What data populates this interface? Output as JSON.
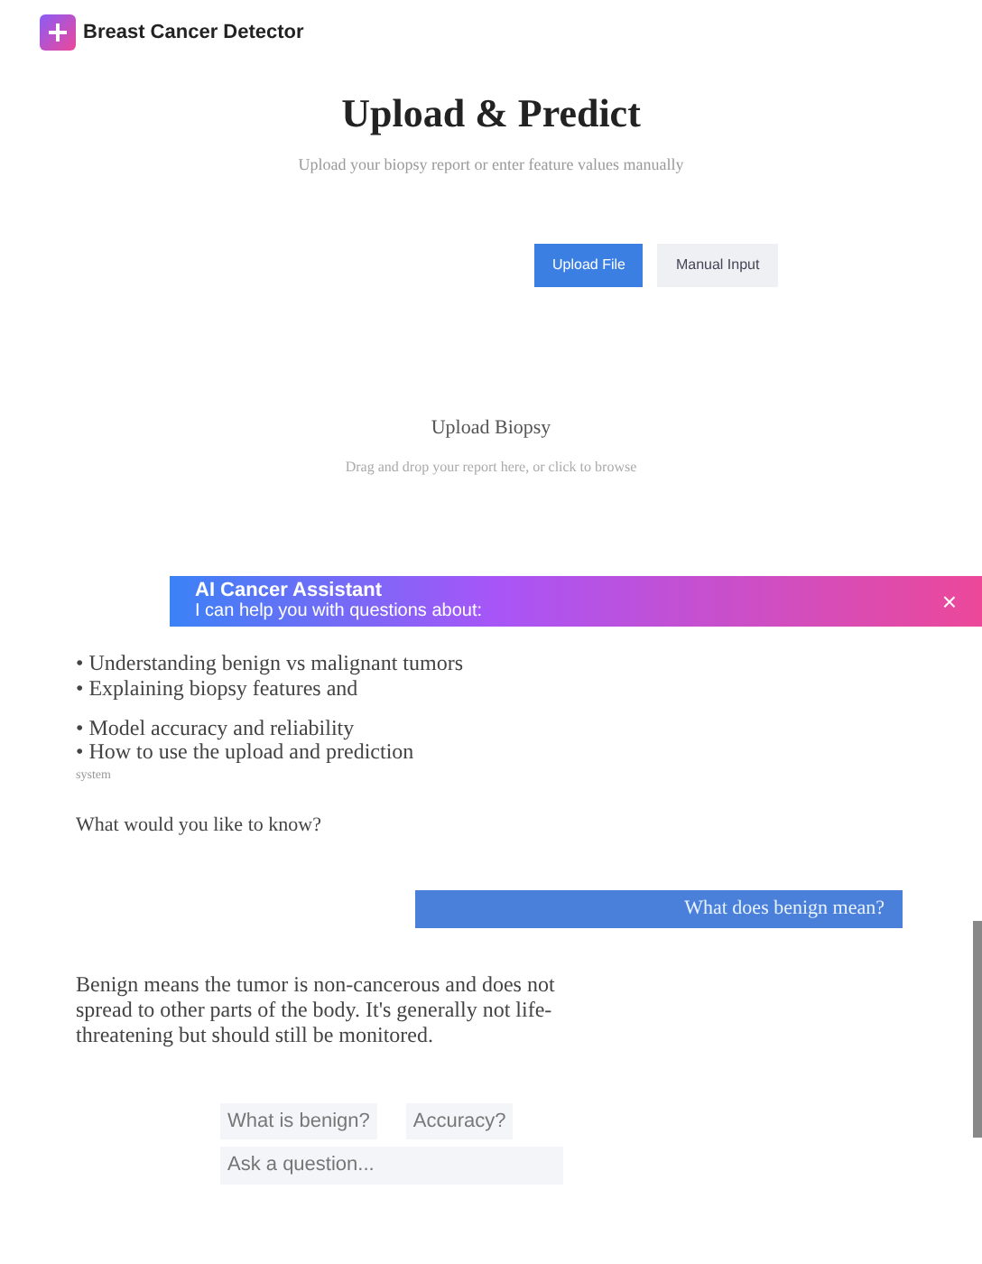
{
  "brand": {
    "name": "Breast Cancer Detector"
  },
  "header": {
    "title": "Upload & Predict",
    "subtitle": "Upload your biopsy report or enter feature values manually"
  },
  "modes": [
    {
      "label": "Upload File",
      "selected": true
    },
    {
      "label": "Manual Input",
      "selected": false
    }
  ],
  "upload": {
    "title": "Upload Biopsy",
    "hint": "Drag and drop your report here, or click to browse"
  },
  "chat": {
    "title": "AI Cancer Assistant",
    "close": "×",
    "intro": "I can help you with questions about:",
    "topics": [
      "• Understanding benign vs malignant tumors",
      "• Explaining biopsy features and",
      "• Model accuracy and reliability",
      "• How to use the upload and prediction"
    ],
    "topic_tail": "system",
    "prompt": "What would you like to know?",
    "messages": [
      {
        "kind": "user",
        "text": "What does benign mean?"
      },
      {
        "kind": "bot",
        "text": "Benign means the tumor is non-cancerous and does not spread to other parts of the body. It's generally not life-threatening but should still be monitored."
      }
    ],
    "suggestions": [
      "What is benign?",
      "Accuracy?"
    ],
    "input": {
      "placeholder": "Ask a question..."
    }
  }
}
